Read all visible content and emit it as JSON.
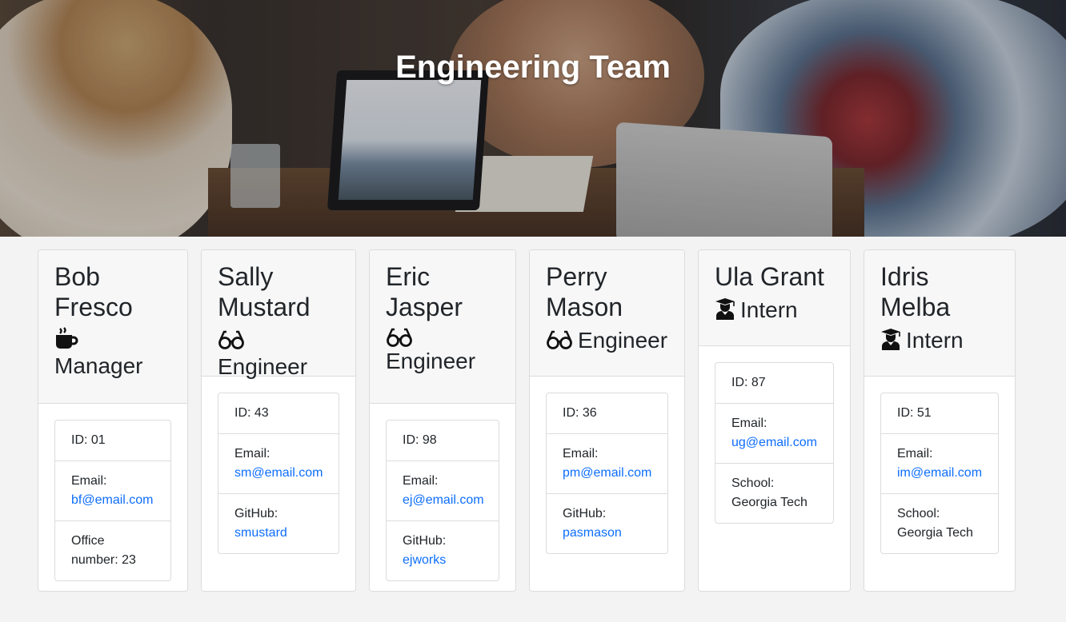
{
  "header": {
    "title": "Engineering Team"
  },
  "team": [
    {
      "name": "Bob Fresco",
      "role": "Manager",
      "role_icon": "coffee-icon",
      "id_label": "ID: 01",
      "email_label": "Email:",
      "email": "bf@email.com",
      "extra_label": "Office number: 23",
      "extra_value": ""
    },
    {
      "name": "Sally Mustard",
      "role": "Engineer",
      "role_icon": "glasses-icon",
      "id_label": "ID: 43",
      "email_label": "Email:",
      "email": "sm@email.com",
      "extra_label": "GitHub:",
      "extra_value": "smustard"
    },
    {
      "name": "Eric Jasper",
      "role": "Engineer",
      "role_icon": "glasses-icon",
      "id_label": "ID: 98",
      "email_label": "Email:",
      "email": "ej@email.com",
      "extra_label": "GitHub:",
      "extra_value": "ejworks"
    },
    {
      "name": "Perry Mason",
      "role": "Engineer",
      "role_icon": "glasses-icon",
      "id_label": "ID: 36",
      "email_label": "Email:",
      "email": "pm@email.com",
      "extra_label": "GitHub:",
      "extra_value": "pasmason"
    },
    {
      "name": "Ula Grant",
      "role": "Intern",
      "role_icon": "graduate-icon",
      "id_label": "ID: 87",
      "email_label": "Email:",
      "email": "ug@email.com",
      "extra_label": "School:",
      "extra_value": "Georgia Tech"
    },
    {
      "name": "Idris Melba",
      "role": "Intern",
      "role_icon": "graduate-icon",
      "id_label": "ID: 51",
      "email_label": "Email:",
      "email": "im@email.com",
      "extra_label": "School:",
      "extra_value": "Georgia Tech"
    }
  ],
  "colors": {
    "link": "#0d6efd",
    "background": "#f3f3f3"
  }
}
